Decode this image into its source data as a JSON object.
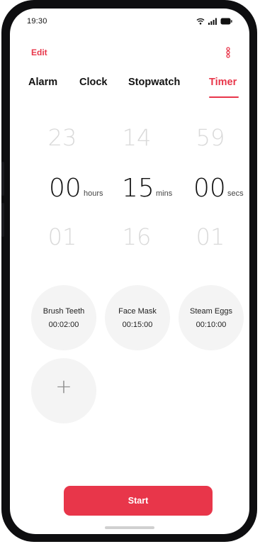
{
  "status_bar": {
    "time": "19:30",
    "icons": [
      "wifi-icon",
      "signal-icon",
      "battery-icon"
    ]
  },
  "header": {
    "edit_label": "Edit",
    "more_icon": "more-vertical-icon"
  },
  "tabs": [
    {
      "label": "Alarm",
      "active": false
    },
    {
      "label": "Clock",
      "active": false
    },
    {
      "label": "Stopwatch",
      "active": false
    },
    {
      "label": "Timer",
      "active": true
    }
  ],
  "picker": {
    "hours": {
      "prev": "23",
      "selected": "00",
      "next": "01",
      "unit": "hours"
    },
    "minutes": {
      "prev": "14",
      "selected": "15",
      "next": "16",
      "unit": "mins"
    },
    "seconds": {
      "prev": "59",
      "selected": "00",
      "next": "01",
      "unit": "secs"
    }
  },
  "presets": [
    {
      "name": "Brush Teeth",
      "duration": "00:02:00"
    },
    {
      "name": "Face Mask",
      "duration": "00:15:00"
    },
    {
      "name": "Steam Eggs",
      "duration": "00:10:00"
    }
  ],
  "add_preset": {
    "symbol": "+"
  },
  "start_label": "Start",
  "colors": {
    "accent": "#e8364a",
    "inactive_number": "#d9d9d9",
    "preset_bg": "#f4f4f4"
  }
}
